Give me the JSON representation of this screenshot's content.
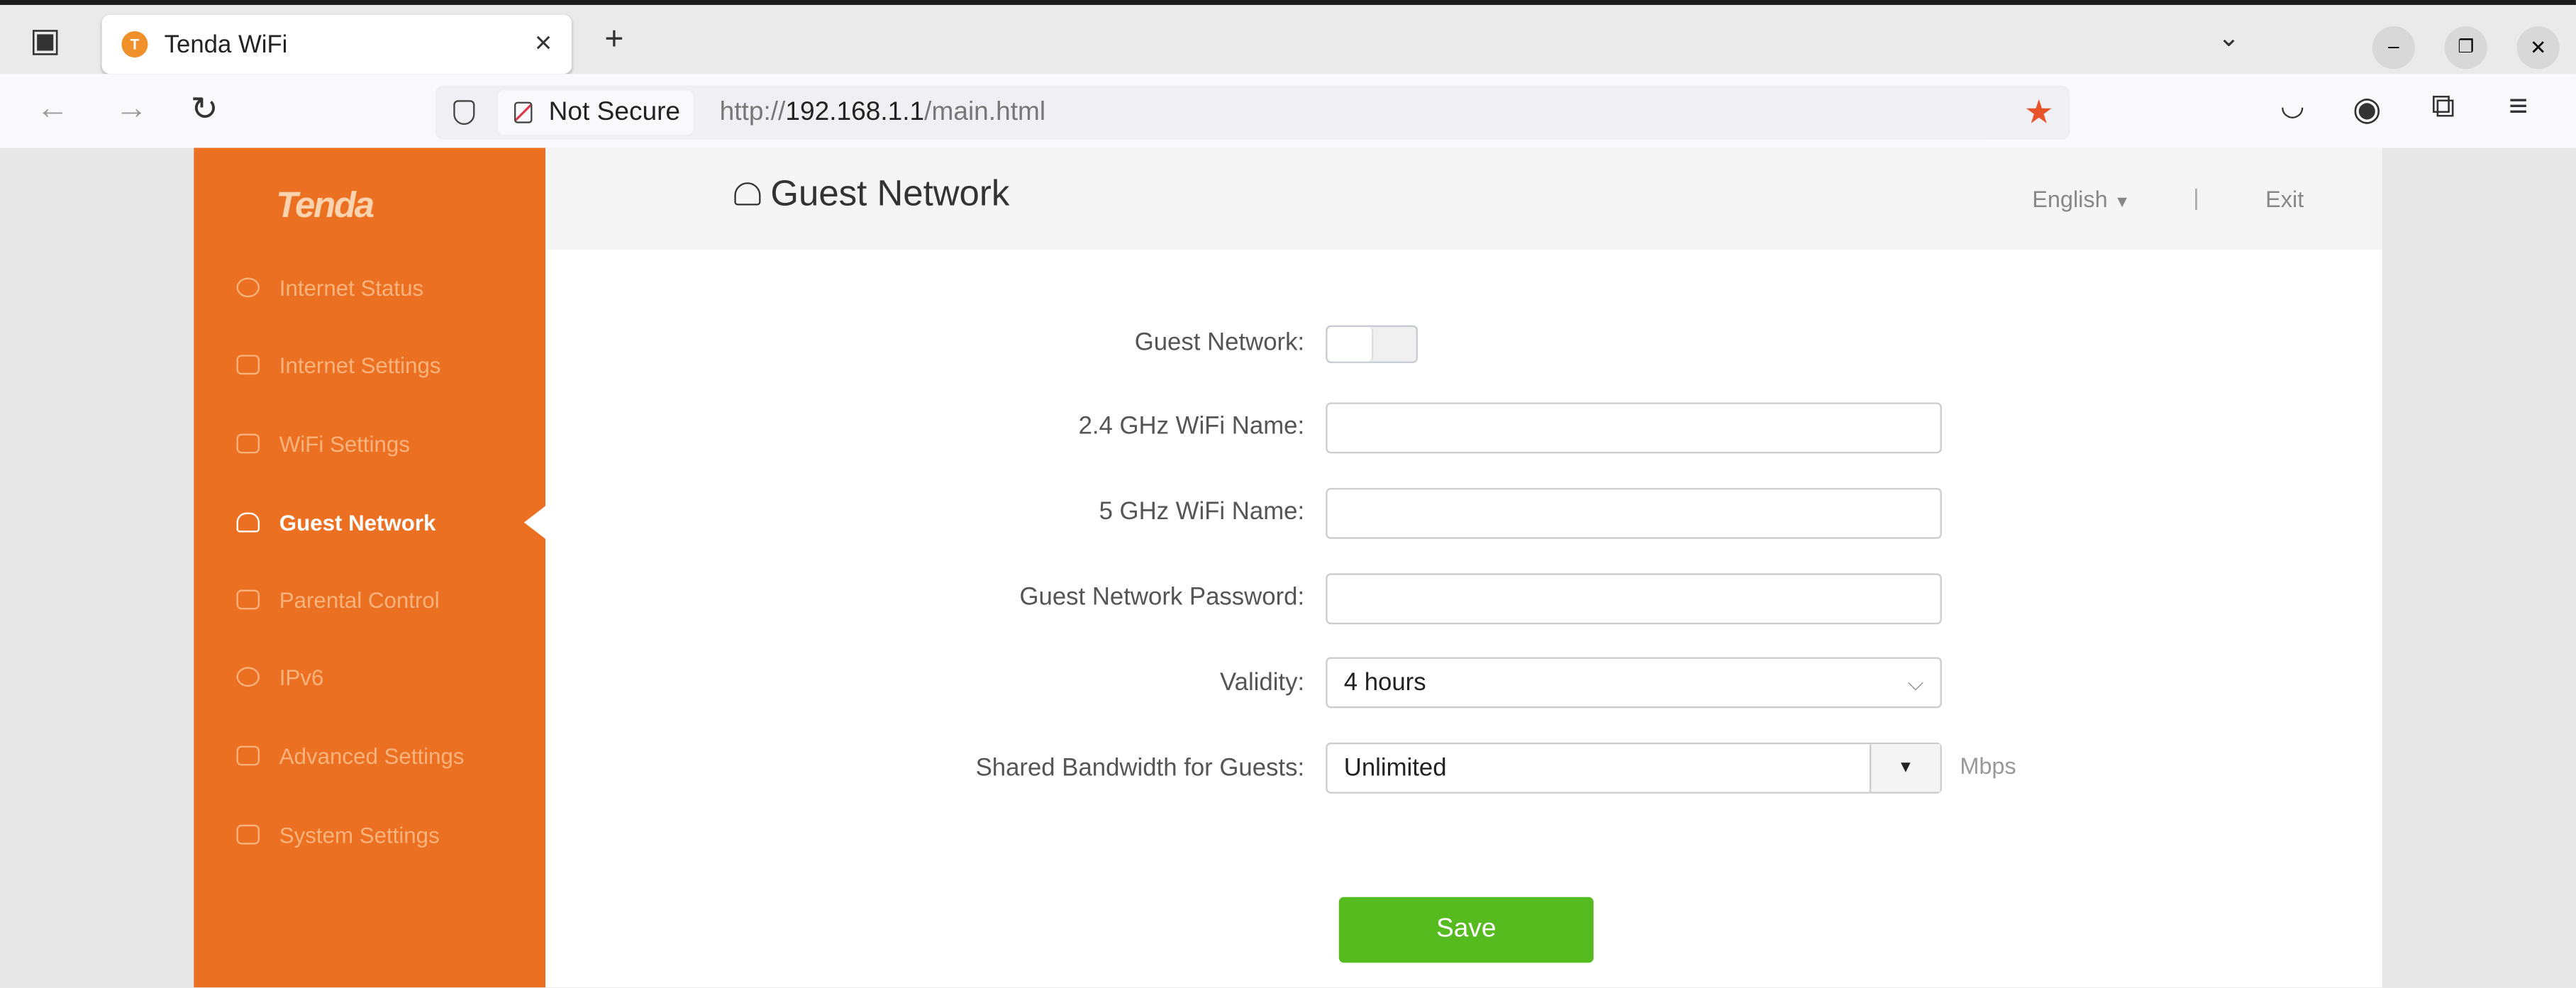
{
  "browser": {
    "tab_title": "Tenda WiFi",
    "tab_close": "×",
    "new_tab": "+",
    "security_label": "Not Secure",
    "url_prefix": "http://",
    "url_host": "192.168.1.1",
    "url_path": "/main.html"
  },
  "sidebar": {
    "logo": "Tenda",
    "items": [
      {
        "label": "Internet Status",
        "icon": "globe-icon"
      },
      {
        "label": "Internet Settings",
        "icon": "internet-settings-icon"
      },
      {
        "label": "WiFi Settings",
        "icon": "wifi-settings-icon"
      },
      {
        "label": "Guest Network",
        "icon": "guest-icon",
        "active": true
      },
      {
        "label": "Parental Control",
        "icon": "parental-icon"
      },
      {
        "label": "IPv6",
        "icon": "ipv6-icon"
      },
      {
        "label": "Advanced Settings",
        "icon": "grid-icon"
      },
      {
        "label": "System Settings",
        "icon": "system-icon"
      }
    ],
    "color": "#ec7022"
  },
  "header": {
    "title": "Guest Network",
    "language": "English",
    "separator": "|",
    "exit": "Exit"
  },
  "form": {
    "guest_network_label": "Guest Network:",
    "guest_network_enabled": false,
    "wifi24_label": "2.4 GHz WiFi Name:",
    "wifi24_value": "",
    "wifi5_label": "5 GHz WiFi Name:",
    "wifi5_value": "",
    "password_label": "Guest Network Password:",
    "password_value": "",
    "validity_label": "Validity:",
    "validity_value": "4 hours",
    "bandwidth_label": "Shared Bandwidth for Guests:",
    "bandwidth_value": "Unlimited",
    "bandwidth_unit": "Mbps",
    "save": "Save",
    "save_color": "#55bb1e"
  }
}
